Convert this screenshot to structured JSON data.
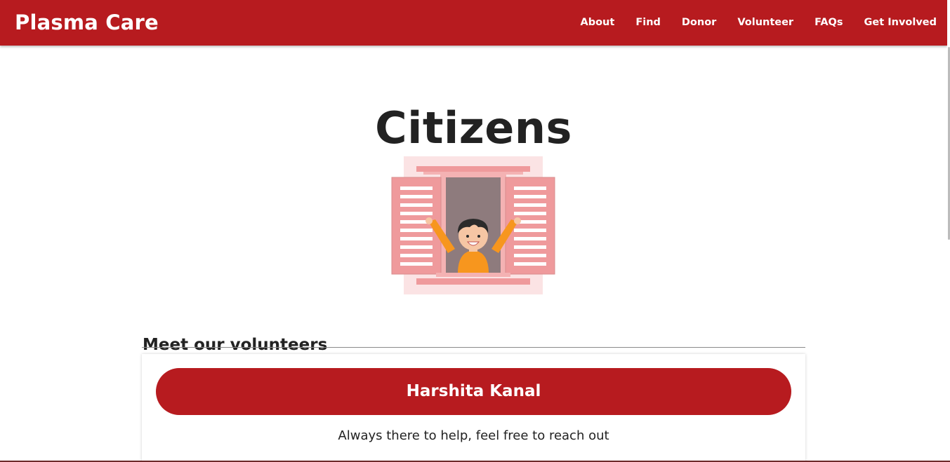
{
  "navbar": {
    "brand": "Plasma Care",
    "links": [
      "About",
      "Find",
      "Donor",
      "Volunteer",
      "FAQs",
      "Get Involved"
    ]
  },
  "main": {
    "title": "Citizens",
    "section_heading": "Meet our volunteers",
    "volunteer": {
      "name": "Harshita Kanal",
      "description": "Always there to help, feel free to reach out"
    }
  },
  "colors": {
    "brand_red": "#b71b1f",
    "window_pink": "#ef9a9c",
    "window_light_pink": "#fbe3e4",
    "interior_gray": "#8e7b7d",
    "shirt_orange": "#f7961e"
  },
  "icons": {
    "illustration": "person-waving-from-window-illustration"
  }
}
